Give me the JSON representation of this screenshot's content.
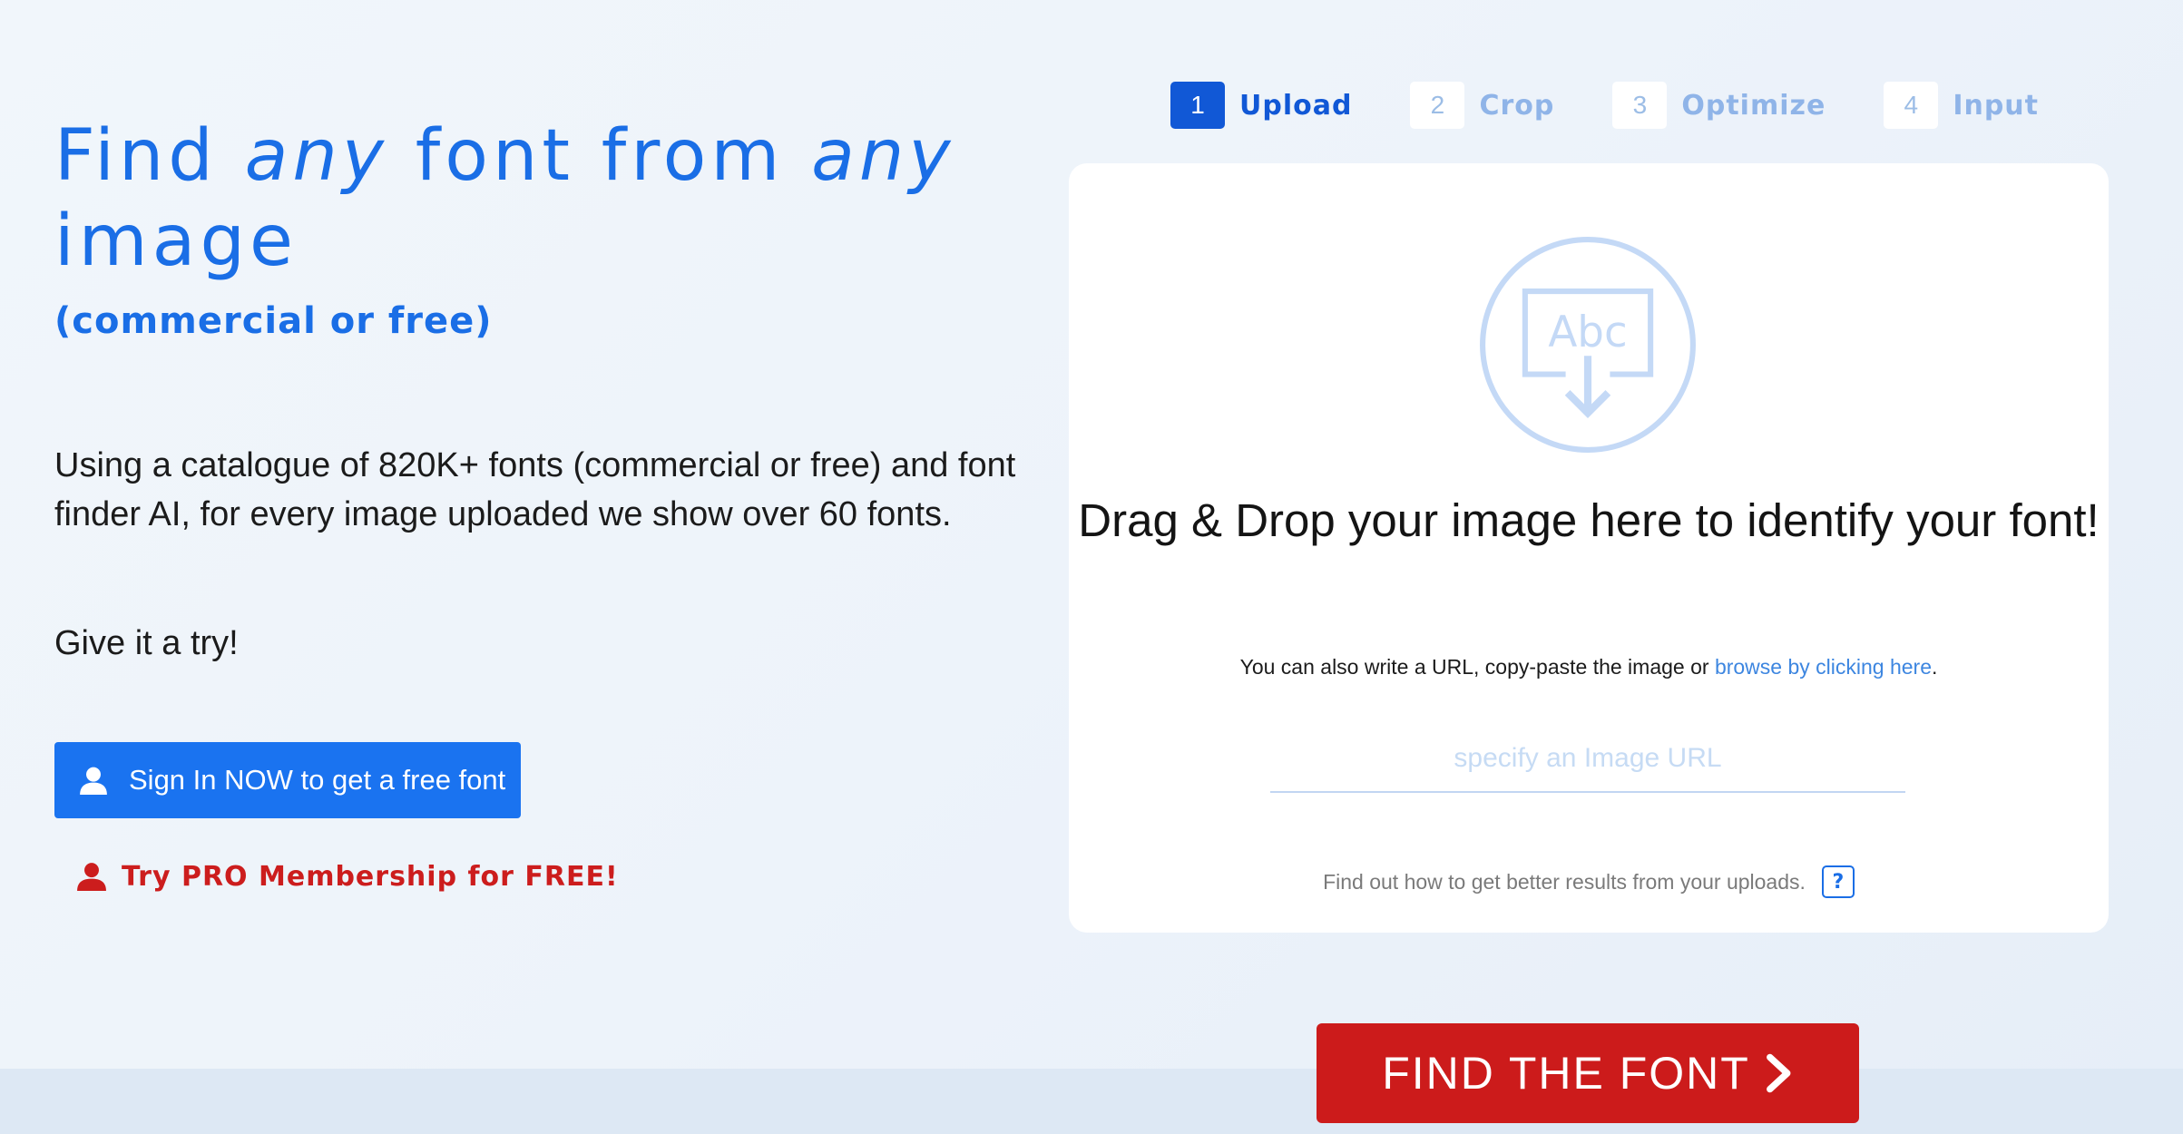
{
  "hero": {
    "headline_part1": "Find ",
    "headline_em1": "any",
    "headline_part2": " font from ",
    "headline_em2": "any",
    "headline_part3": " image",
    "subheadline": "(commercial or free)",
    "description": "Using a catalogue of 820K+ fonts (commercial or free) and font finder AI, for every image uploaded we show over 60 fonts.",
    "try_text": "Give it a try!",
    "signin_label": "Sign In NOW to get a free font",
    "pro_label": "Try PRO Membership for FREE!"
  },
  "steps": [
    {
      "num": "1",
      "label": "Upload",
      "active": true
    },
    {
      "num": "2",
      "label": "Crop",
      "active": false
    },
    {
      "num": "3",
      "label": "Optimize",
      "active": false
    },
    {
      "num": "4",
      "label": "Input",
      "active": false
    }
  ],
  "upload": {
    "icon_text": "Abc",
    "drop_title": "Drag & Drop your image here to identify your font!",
    "alt_text_prefix": "You can also write a URL, copy-paste the image or ",
    "browse_link": "browse by clicking here",
    "alt_text_suffix": ".",
    "url_value": "",
    "url_placeholder": "specify an Image URL",
    "help_text": "Find out how to get better results from your uploads.",
    "help_button": "?"
  },
  "find_button": {
    "label": "FIND THE FONT"
  },
  "icons": {
    "signin": "user-icon",
    "pro": "user-icon",
    "upload": "upload-image-icon",
    "find": "chevron-right-icon"
  },
  "colors": {
    "primary_blue": "#1a6ee6",
    "active_step": "#1158d6",
    "inactive_step": "#8fb4e8",
    "signin_button": "#1a73f0",
    "accent_red": "#cc1b1b",
    "link_blue": "#3d86e0"
  }
}
